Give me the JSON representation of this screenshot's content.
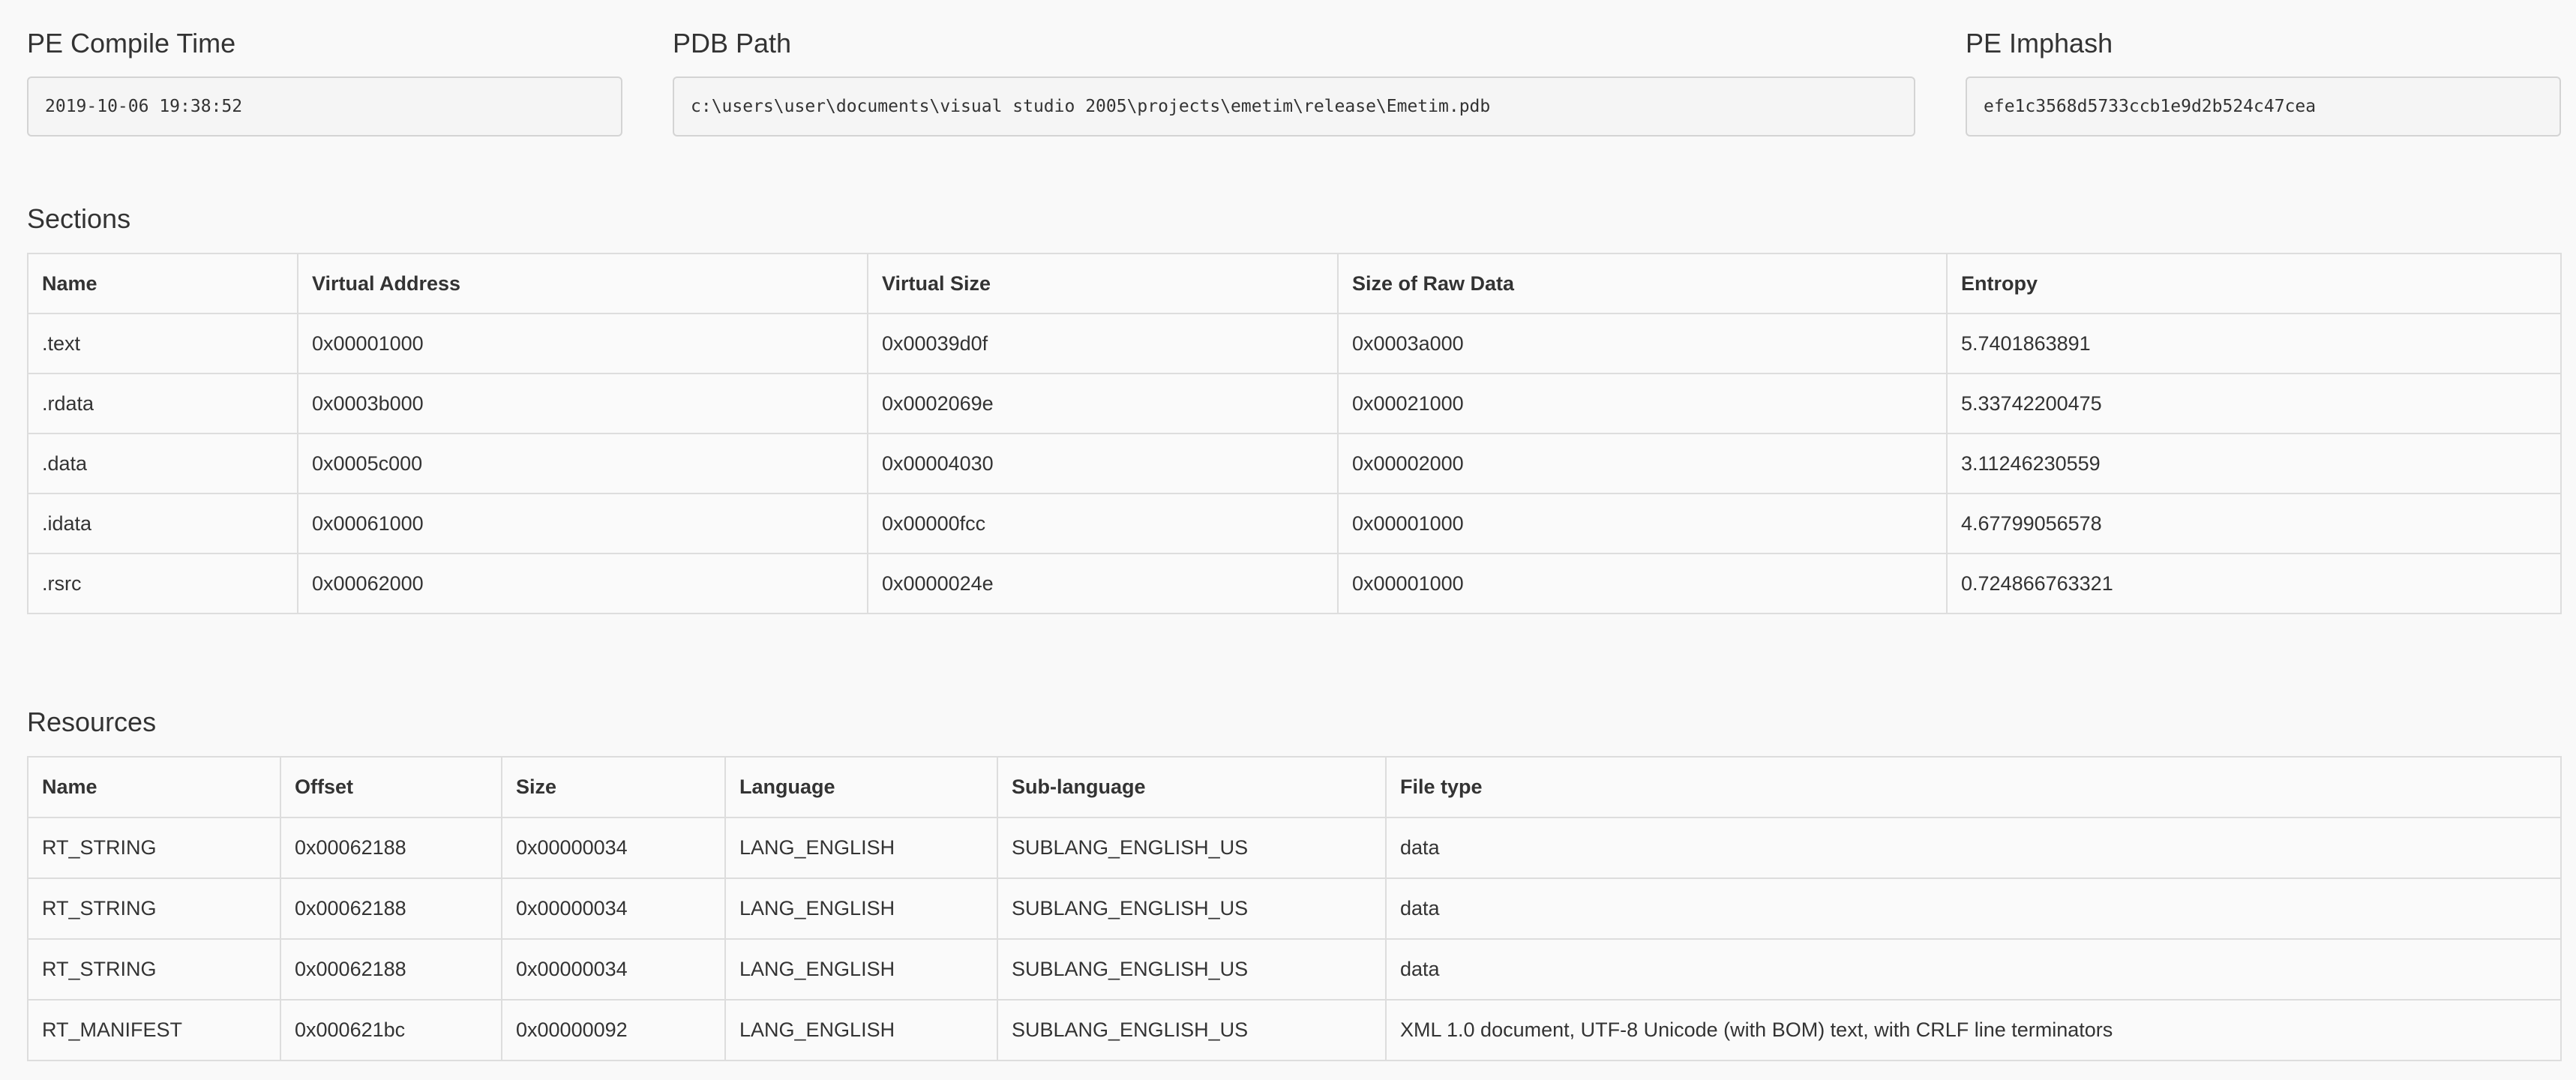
{
  "fields": {
    "compile_time": {
      "label": "PE Compile Time",
      "value": "2019-10-06 19:38:52"
    },
    "pdb_path": {
      "label": "PDB Path",
      "value": "c:\\users\\user\\documents\\visual studio 2005\\projects\\emetim\\release\\Emetim.pdb"
    },
    "imphash": {
      "label": "PE Imphash",
      "value": "efe1c3568d5733ccb1e9d2b524c47cea"
    }
  },
  "sections": {
    "title": "Sections",
    "columns": [
      "Name",
      "Virtual Address",
      "Virtual Size",
      "Size of Raw Data",
      "Entropy"
    ],
    "rows": [
      [
        ".text",
        "0x00001000",
        "0x00039d0f",
        "0x0003a000",
        "5.7401863891"
      ],
      [
        ".rdata",
        "0x0003b000",
        "0x0002069e",
        "0x00021000",
        "5.33742200475"
      ],
      [
        ".data",
        "0x0005c000",
        "0x00004030",
        "0x00002000",
        "3.11246230559"
      ],
      [
        ".idata",
        "0x00061000",
        "0x00000fcc",
        "0x00001000",
        "4.67799056578"
      ],
      [
        ".rsrc",
        "0x00062000",
        "0x0000024e",
        "0x00001000",
        "0.724866763321"
      ]
    ]
  },
  "resources": {
    "title": "Resources",
    "columns": [
      "Name",
      "Offset",
      "Size",
      "Language",
      "Sub-language",
      "File type"
    ],
    "rows": [
      [
        "RT_STRING",
        "0x00062188",
        "0x00000034",
        "LANG_ENGLISH",
        "SUBLANG_ENGLISH_US",
        "data"
      ],
      [
        "RT_STRING",
        "0x00062188",
        "0x00000034",
        "LANG_ENGLISH",
        "SUBLANG_ENGLISH_US",
        "data"
      ],
      [
        "RT_STRING",
        "0x00062188",
        "0x00000034",
        "LANG_ENGLISH",
        "SUBLANG_ENGLISH_US",
        "data"
      ],
      [
        "RT_MANIFEST",
        "0x000621bc",
        "0x00000092",
        "LANG_ENGLISH",
        "SUBLANG_ENGLISH_US",
        "XML 1.0 document, UTF-8 Unicode (with BOM) text, with CRLF line terminators"
      ]
    ]
  }
}
